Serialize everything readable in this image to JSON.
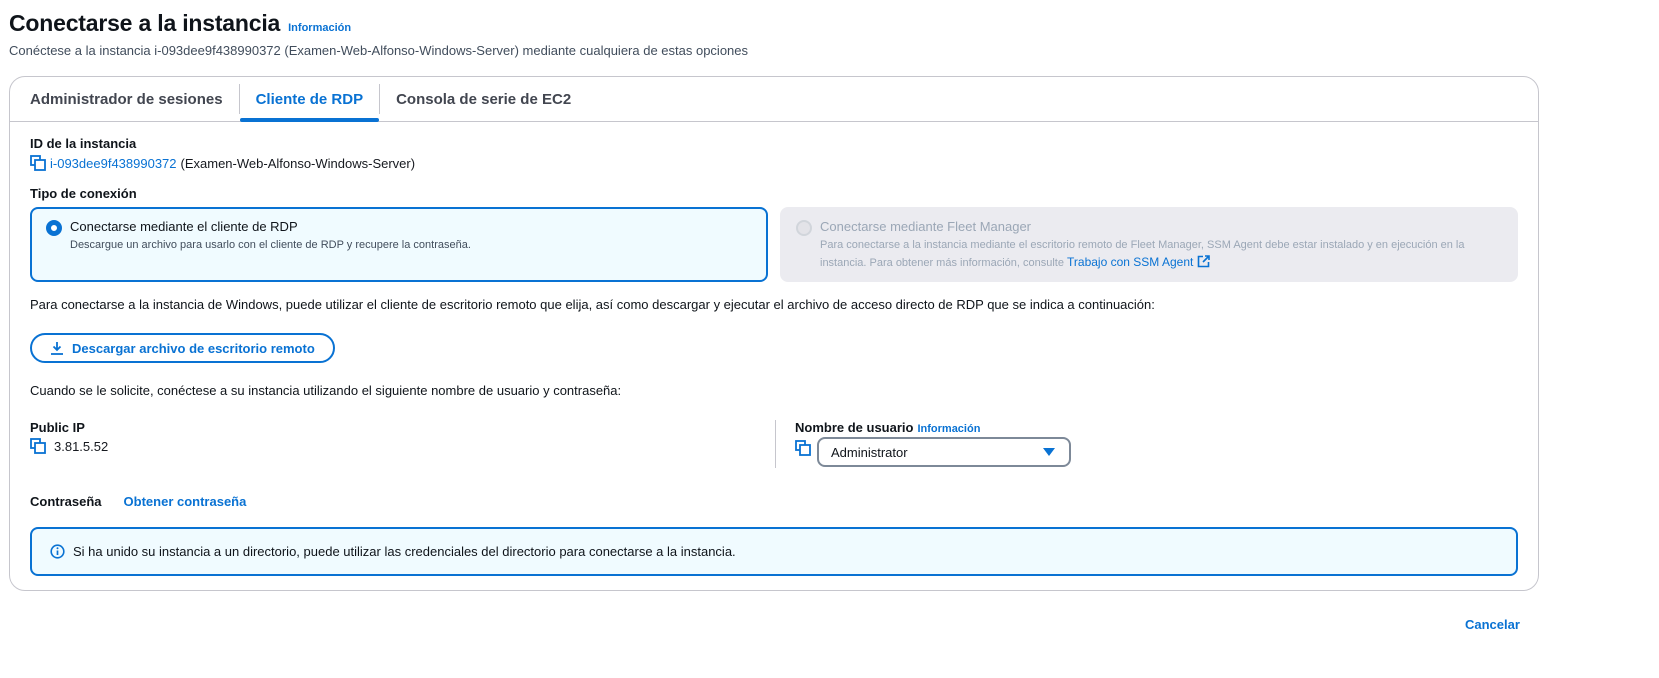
{
  "header": {
    "title": "Conectarse a la instancia",
    "info_link": "Información",
    "subtitle": "Conéctese a la instancia i-093dee9f438990372 (Examen-Web-Alfonso-Windows-Server) mediante cualquiera de estas opciones"
  },
  "tabs": [
    {
      "label": "Administrador de sesiones",
      "active": false
    },
    {
      "label": "Cliente de RDP",
      "active": true
    },
    {
      "label": "Consola de serie de EC2",
      "active": false
    }
  ],
  "instance": {
    "label": "ID de la instancia",
    "id": "i-093dee9f438990372",
    "name": "(Examen-Web-Alfonso-Windows-Server)"
  },
  "connection_type": {
    "label": "Tipo de conexión",
    "options": [
      {
        "title": "Conectarse mediante el cliente de RDP",
        "description": "Descargue un archivo para usarlo con el cliente de RDP y recupere la contraseña.",
        "selected": true
      },
      {
        "title": "Conectarse mediante Fleet Manager",
        "description_line1": "Para conectarse a la instancia mediante el escritorio remoto de Fleet Manager, SSM Agent debe estar instalado y en ejecución en la",
        "description_line2": "instancia. Para obtener más información, consulte",
        "link": "Trabajo con SSM Agent",
        "selected": false,
        "disabled": true
      }
    ]
  },
  "rdp_paragraph": "Para conectarse a la instancia de Windows, puede utilizar el cliente de escritorio remoto que elija, así como descargar y ejecutar el archivo de acceso directo de RDP que se indica a continuación:",
  "download_button": "Descargar archivo de escritorio remoto",
  "credentials_paragraph": "Cuando se le solicite, conéctese a su instancia utilizando el siguiente nombre de usuario y contraseña:",
  "public_ip": {
    "label": "Public IP",
    "value": "3.81.5.52"
  },
  "username": {
    "label": "Nombre de usuario",
    "info_link": "Información",
    "value": "Administrator"
  },
  "password": {
    "label": "Contraseña",
    "action": "Obtener contraseña"
  },
  "alert": {
    "text": "Si ha unido su instancia a un directorio, puede utilizar las credenciales del directorio para conectarse a la instancia."
  },
  "footer": {
    "cancel": "Cancelar"
  },
  "colors": {
    "accent": "#0972d3",
    "border": "#c6c6cd",
    "info_bg": "#f0fbff"
  }
}
